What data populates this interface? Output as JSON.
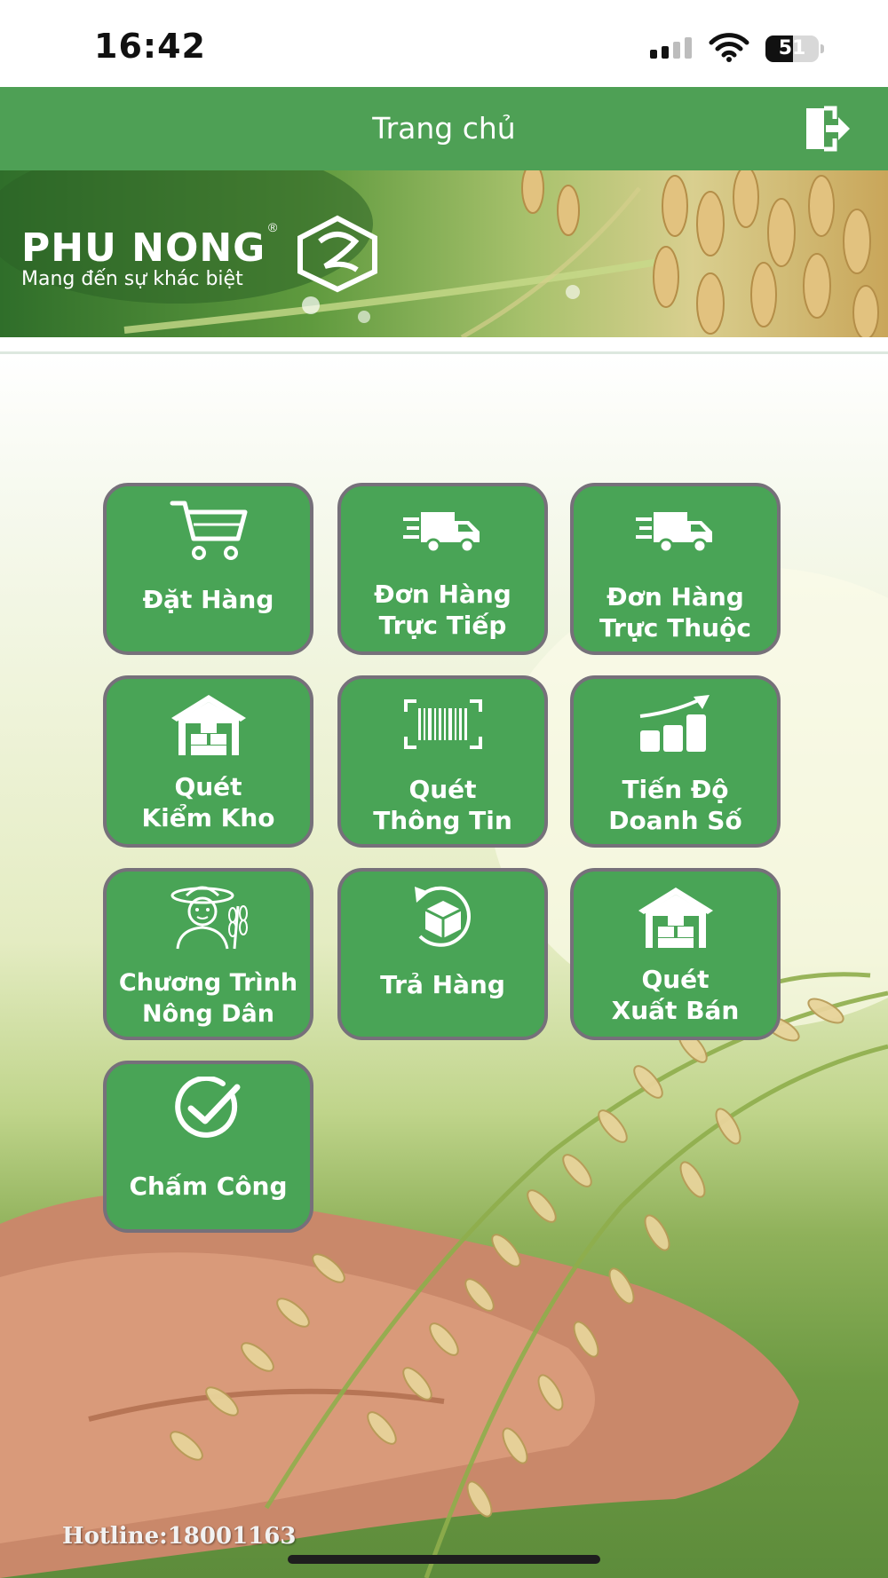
{
  "status_bar": {
    "time": "16:42",
    "battery": "51",
    "battery_level": 0.51
  },
  "header": {
    "title": "Trang chủ",
    "logout_icon": "logout-icon"
  },
  "banner": {
    "brand": "PHU NONG",
    "registered": "®",
    "tagline": "Mang đến sự khác biệt"
  },
  "tiles": [
    {
      "label": "Đặt Hàng",
      "icon": "cart-icon"
    },
    {
      "label": "Đơn Hàng\nTrực Tiếp",
      "icon": "delivery-truck-icon"
    },
    {
      "label": "Đơn Hàng\nTrực Thuộc",
      "icon": "delivery-truck-icon"
    },
    {
      "label": "Quét\nKiểm Kho",
      "icon": "warehouse-icon"
    },
    {
      "label": "Quét\nThông Tin",
      "icon": "barcode-scan-icon"
    },
    {
      "label": "Tiến Độ\nDoanh Số",
      "icon": "sales-growth-chart-icon"
    },
    {
      "label": "Chương Trình\nNông Dân",
      "icon": "farmer-icon"
    },
    {
      "label": "Trả Hàng",
      "icon": "return-package-icon"
    },
    {
      "label": "Quét\nXuất Bán",
      "icon": "warehouse-icon"
    },
    {
      "label": "Chấm Công",
      "icon": "check-circle-icon"
    }
  ],
  "footer": {
    "hotline": "Hotline:18001163"
  },
  "colors": {
    "header_green": "#4ea055",
    "tile_green": "#49a456",
    "tile_border": "#76707a"
  }
}
